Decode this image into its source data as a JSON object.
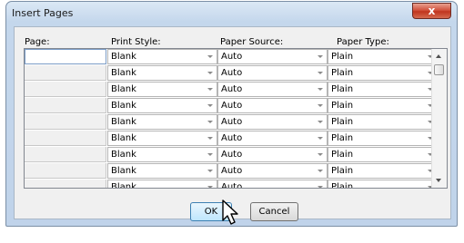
{
  "window": {
    "title": "Insert Pages",
    "close_label": "x"
  },
  "columns": {
    "page": "Page:",
    "print_style": "Print Style:",
    "paper_source": "Paper Source:",
    "paper_type": "Paper Type:"
  },
  "rows": [
    {
      "page": "",
      "print_style": "Blank",
      "paper_source": "Auto",
      "paper_type": "Plain"
    },
    {
      "page": "",
      "print_style": "Blank",
      "paper_source": "Auto",
      "paper_type": "Plain"
    },
    {
      "page": "",
      "print_style": "Blank",
      "paper_source": "Auto",
      "paper_type": "Plain"
    },
    {
      "page": "",
      "print_style": "Blank",
      "paper_source": "Auto",
      "paper_type": "Plain"
    },
    {
      "page": "",
      "print_style": "Blank",
      "paper_source": "Auto",
      "paper_type": "Plain"
    },
    {
      "page": "",
      "print_style": "Blank",
      "paper_source": "Auto",
      "paper_type": "Plain"
    },
    {
      "page": "",
      "print_style": "Blank",
      "paper_source": "Auto",
      "paper_type": "Plain"
    },
    {
      "page": "",
      "print_style": "Blank",
      "paper_source": "Auto",
      "paper_type": "Plain"
    },
    {
      "page": "",
      "print_style": "Blank",
      "paper_source": "Auto",
      "paper_type": "Plain"
    }
  ],
  "buttons": {
    "ok": "OK",
    "cancel": "Cancel"
  },
  "icons": {
    "close": "close-icon",
    "cursor": "mouse-pointer-icon"
  }
}
